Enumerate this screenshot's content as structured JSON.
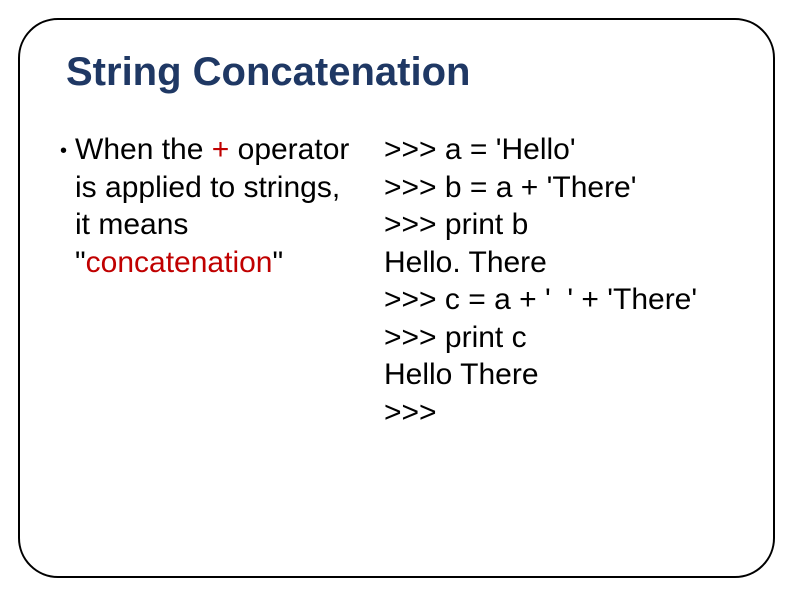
{
  "title": "String Concatenation",
  "bullet": {
    "marker": "•",
    "prefix": "When the ",
    "plus": "+",
    "mid": " operator is applied to strings, it means \"",
    "concat": "concatenation",
    "suffix": "\""
  },
  "code": {
    "l1": ">>> a = 'Hello'",
    "l2": ">>> b = a + 'There'",
    "l3": ">>> print b",
    "l4": "Hello. There",
    "l5": ">>> c = a + '  ' + 'There'",
    "l6": ">>> print c",
    "l7": "Hello There",
    "l8": ">>>"
  }
}
